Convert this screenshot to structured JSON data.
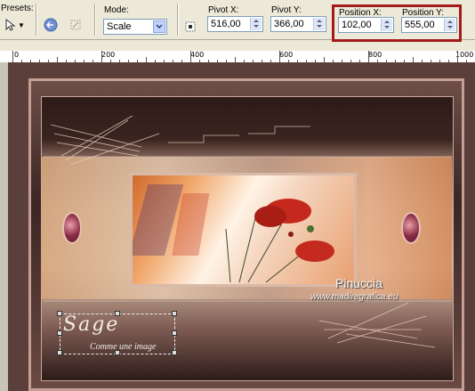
{
  "toolbar": {
    "presets_label": "Presets:",
    "mode_label": "Mode:",
    "mode_value": "Scale",
    "pivot_x_label": "Pivot X:",
    "pivot_x_value": "516,00",
    "pivot_y_label": "Pivot Y:",
    "pivot_y_value": "366,00",
    "position_x_label": "Position X:",
    "position_x_value": "102,00",
    "position_y_label": "Position Y:",
    "position_y_value": "555,00",
    "highlight_color": "#a51a1a"
  },
  "ruler": {
    "labels": [
      "0",
      "200",
      "400",
      "600",
      "800",
      "1000"
    ]
  },
  "canvas": {
    "signature_title": "Sage",
    "signature_subtitle": "Comme une image",
    "watermark_name": "Pinuccia",
    "watermark_site": "www.madiregrafica.eu"
  }
}
